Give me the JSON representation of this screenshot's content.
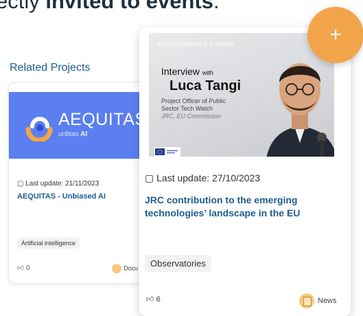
{
  "heading": {
    "prefix": "ectly ",
    "bold": "invited to events",
    "suffix": "."
  },
  "related": {
    "title": "Related Projects"
  },
  "back_card": {
    "logo_name": "AEQUITAS",
    "logo_sub_prefix": "unbias",
    "logo_sub_bold": "AI",
    "last_update": "Last update: 21/11/2023",
    "title": "AEQUITAS - Unbiased AI",
    "tag": "Artificial intelligence",
    "likes": "0",
    "type": "Docu"
  },
  "front_card": {
    "photo_brand": "INTEROPERABLE EUROPE",
    "photo_interview": "Interview",
    "photo_with": "with",
    "photo_name": "Luca Tangi",
    "photo_role_1": "Project Officer of Public",
    "photo_role_2": "Sector Tech Watch",
    "photo_role_3": "JRC, EU Commission",
    "last_update": "Last update: 27/10/2023",
    "title": "JRC contribution to the emerging technologies’ landscape in the EU",
    "tag": "Observatories",
    "likes": "6",
    "type": "News"
  },
  "fab": {
    "label": "+"
  },
  "colors": {
    "accent": "#f2a44b",
    "link": "#1e5c8f",
    "banner": "#5b7ff0"
  }
}
